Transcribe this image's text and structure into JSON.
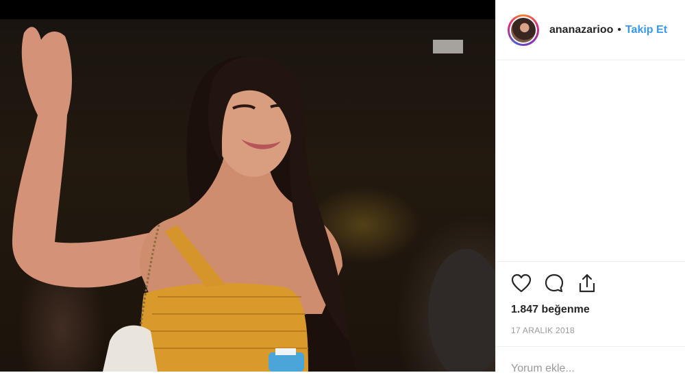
{
  "post": {
    "username": "ananazarioo",
    "separator": "•",
    "follow_label": "Takip Et",
    "likes_text": "1.847 beğenme",
    "date_text": "17 ARALIK 2018",
    "comment_placeholder": "Yorum ekle..."
  },
  "icons": {
    "like": "heart-icon",
    "comment": "comment-icon",
    "share": "share-icon"
  },
  "colors": {
    "link_blue": "#3897f0",
    "text": "#262626",
    "muted": "#999999"
  }
}
